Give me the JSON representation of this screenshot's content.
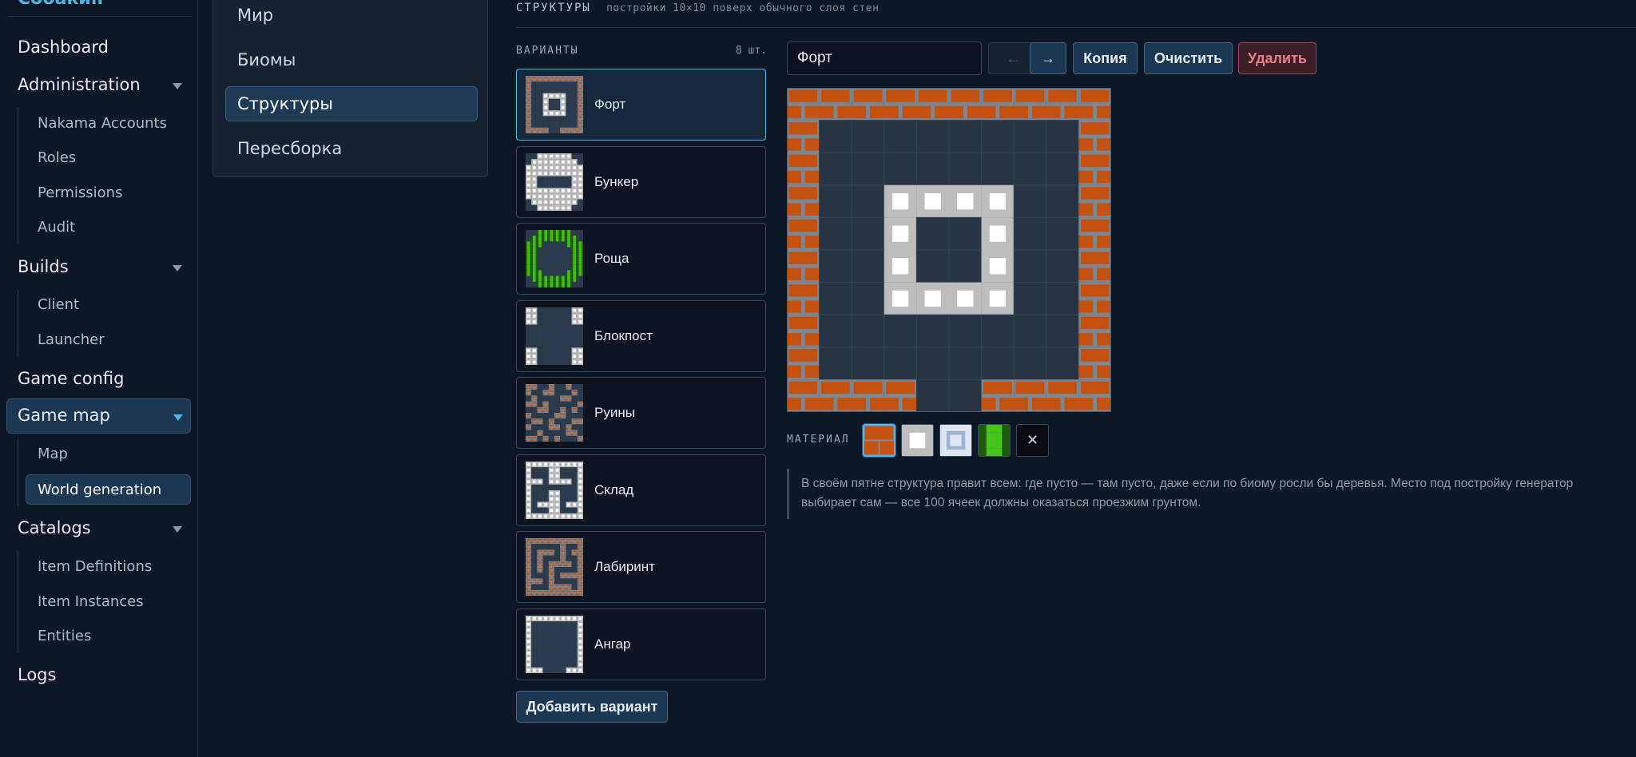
{
  "sidebar": {
    "brand": "Собакин",
    "items": [
      {
        "label": "Dashboard"
      },
      {
        "label": "Administration",
        "children": [
          "Nakama Accounts",
          "Roles",
          "Permissions",
          "Audit"
        ]
      },
      {
        "label": "Builds",
        "children": [
          "Client",
          "Launcher"
        ]
      },
      {
        "label": "Game config"
      },
      {
        "label": "Game map",
        "active": true,
        "children": [
          "Map",
          "World generation"
        ],
        "active_child": "World generation"
      },
      {
        "label": "Catalogs",
        "children": [
          "Item Definitions",
          "Item Instances",
          "Entities"
        ]
      },
      {
        "label": "Logs"
      }
    ]
  },
  "sections": {
    "items": [
      "Мир",
      "Биомы",
      "Структуры",
      "Пересборка"
    ],
    "active": "Структуры"
  },
  "header": {
    "title": "СТРУКТУРЫ",
    "subtitle": "постройки 10×10 поверх обычного слоя стен"
  },
  "variants": {
    "label": "ВАРИАНТЫ",
    "count": "8 шт.",
    "items": [
      {
        "name": "Форт",
        "selected": true,
        "thumb": "fort"
      },
      {
        "name": "Бункер",
        "thumb": "bunker"
      },
      {
        "name": "Роща",
        "thumb": "grove"
      },
      {
        "name": "Блокпост",
        "thumb": "checkpoint"
      },
      {
        "name": "Руины",
        "thumb": "ruins"
      },
      {
        "name": "Склад",
        "thumb": "warehouse"
      },
      {
        "name": "Лабиринт",
        "thumb": "maze"
      },
      {
        "name": "Ангар",
        "thumb": "hangar"
      }
    ],
    "add_label": "Добавить вариант"
  },
  "editor": {
    "name_value": "Форт",
    "prev_label": "←",
    "next_label": "→",
    "copy_label": "Копия",
    "clear_label": "Очистить",
    "delete_label": "Удалить",
    "grid_legend": {
      ".": "empty",
      "B": "brick",
      "S": "steel"
    },
    "grid": [
      "BBBBBBBBBB",
      "B........B",
      "B........B",
      "B..SSSS..B",
      "B..S..S..B",
      "B..S..S..B",
      "B..SSSS..B",
      "B........B",
      "B........B",
      "BBBB..BBBB"
    ],
    "material_label": "МАТЕРИАЛ",
    "materials": [
      "brick",
      "steel",
      "ice",
      "grass",
      "erase"
    ],
    "selected_material": "brick",
    "note": "В своём пятне структура правит всем: где пусто — там пусто, даже если по биому росли бы деревья. Место под постройку генератор выбирает сам — все 100 ячеек должны оказаться проезжим грунтом."
  },
  "colors": {
    "accent": "#4fb6e8",
    "brick": "#c4520e",
    "mortar": "#7a8794",
    "steel": "#bdbdbd",
    "empty_cell": "#263444",
    "grass": "#3fbf18",
    "danger": "#f07a86"
  }
}
